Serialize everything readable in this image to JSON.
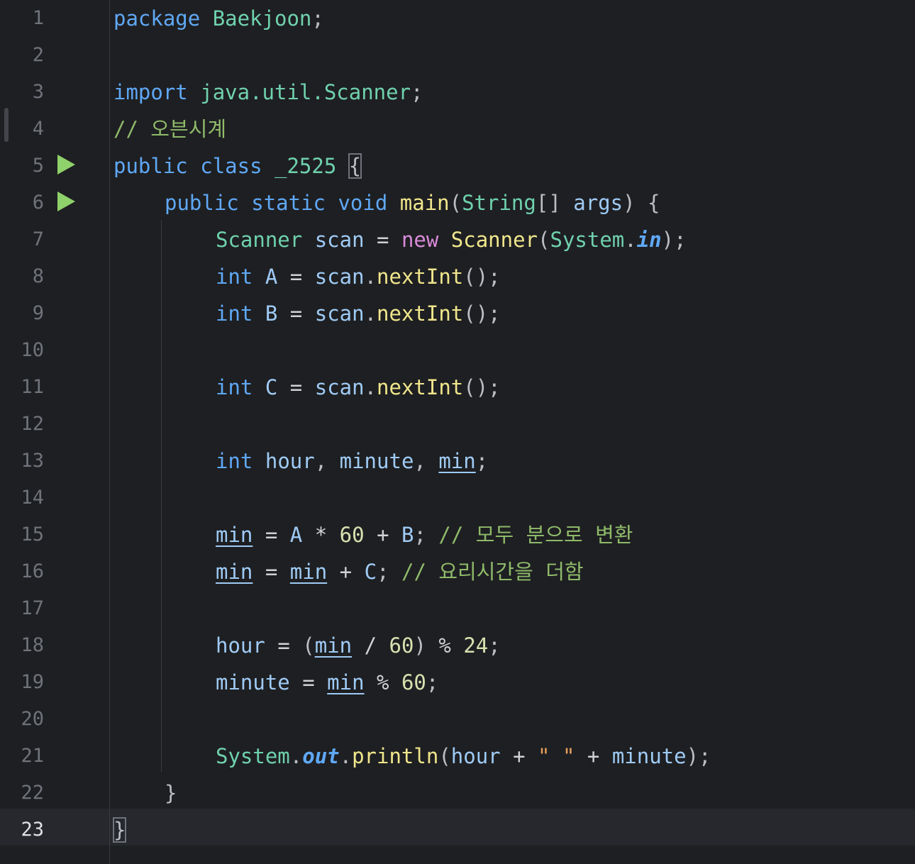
{
  "gutter": {
    "line_numbers": [
      "1",
      "2",
      "3",
      "4",
      "5",
      "6",
      "7",
      "8",
      "9",
      "10",
      "11",
      "12",
      "13",
      "14",
      "15",
      "16",
      "17",
      "18",
      "19",
      "20",
      "21",
      "22",
      "23"
    ],
    "active_line": "23"
  },
  "code": {
    "l1": {
      "kw": "package",
      "name": "Baekjoon",
      "end": ";"
    },
    "l3": {
      "kw": "import",
      "name": "java.util.Scanner",
      "end": ";"
    },
    "l4": {
      "comment": "// 오븐시계"
    },
    "l5": {
      "kw1": "public",
      "kw2": "class",
      "name": "_2525",
      "brace": "{"
    },
    "l6": {
      "kw1": "public",
      "kw2": "static",
      "kw3": "void",
      "meth": "main",
      "p1": "(",
      "type": "String",
      "arr": "[]",
      "arg": "args",
      "p2": ")",
      "brace": "{"
    },
    "l7": {
      "type": "Scanner",
      "var": "scan",
      "eq": "=",
      "new": "new",
      "ctor": "Scanner",
      "p1": "(",
      "sys": "System",
      "dot": ".",
      "field": "in",
      "end": ");"
    },
    "l8": {
      "type": "int",
      "var": "A",
      "eq": "=",
      "obj": "scan",
      "dot": ".",
      "meth": "nextInt",
      "end": "();"
    },
    "l9": {
      "type": "int",
      "var": "B",
      "eq": "=",
      "obj": "scan",
      "dot": ".",
      "meth": "nextInt",
      "end": "();"
    },
    "l11": {
      "type": "int",
      "var": "C",
      "eq": "=",
      "obj": "scan",
      "dot": ".",
      "meth": "nextInt",
      "end": "();"
    },
    "l13": {
      "type": "int",
      "v1": "hour",
      "c1": ",",
      "v2": "minute",
      "c2": ",",
      "v3": "min",
      "end": ";"
    },
    "l15": {
      "v": "min",
      "eq": "=",
      "a": "A",
      "mul": "*",
      "n": "60",
      "plus": "+",
      "b": "B",
      "end": ";",
      "comment": "// 모두 분으로 변환"
    },
    "l16": {
      "v": "min",
      "eq": "=",
      "v2": "min",
      "plus": "+",
      "c": "C",
      "end": ";",
      "comment": "// 요리시간을 더함"
    },
    "l18": {
      "v": "hour",
      "eq": "=",
      "p1": "(",
      "v2": "min",
      "div": "/",
      "n1": "60",
      "p2": ")",
      "mod": "%",
      "n2": "24",
      "end": ";"
    },
    "l19": {
      "v": "minute",
      "eq": "=",
      "v2": "min",
      "mod": "%",
      "n": "60",
      "end": ";"
    },
    "l21": {
      "sys": "System",
      "dot": ".",
      "field": "out",
      "dot2": ".",
      "meth": "println",
      "p1": "(",
      "v1": "hour",
      "plus1": "+",
      "str": "\" \"",
      "plus2": "+",
      "v2": "minute",
      "end": ");"
    },
    "l22": {
      "brace": "}"
    },
    "l23": {
      "brace": "}"
    }
  },
  "colors": {
    "background": "#1e1f22",
    "keyword": "#5fa8f5",
    "class": "#6fd1ad",
    "method": "#f0e68c",
    "comment": "#8fba6a",
    "string": "#e8a05c",
    "run_icon": "#8fd16a"
  },
  "icons": [
    "run-icon"
  ]
}
